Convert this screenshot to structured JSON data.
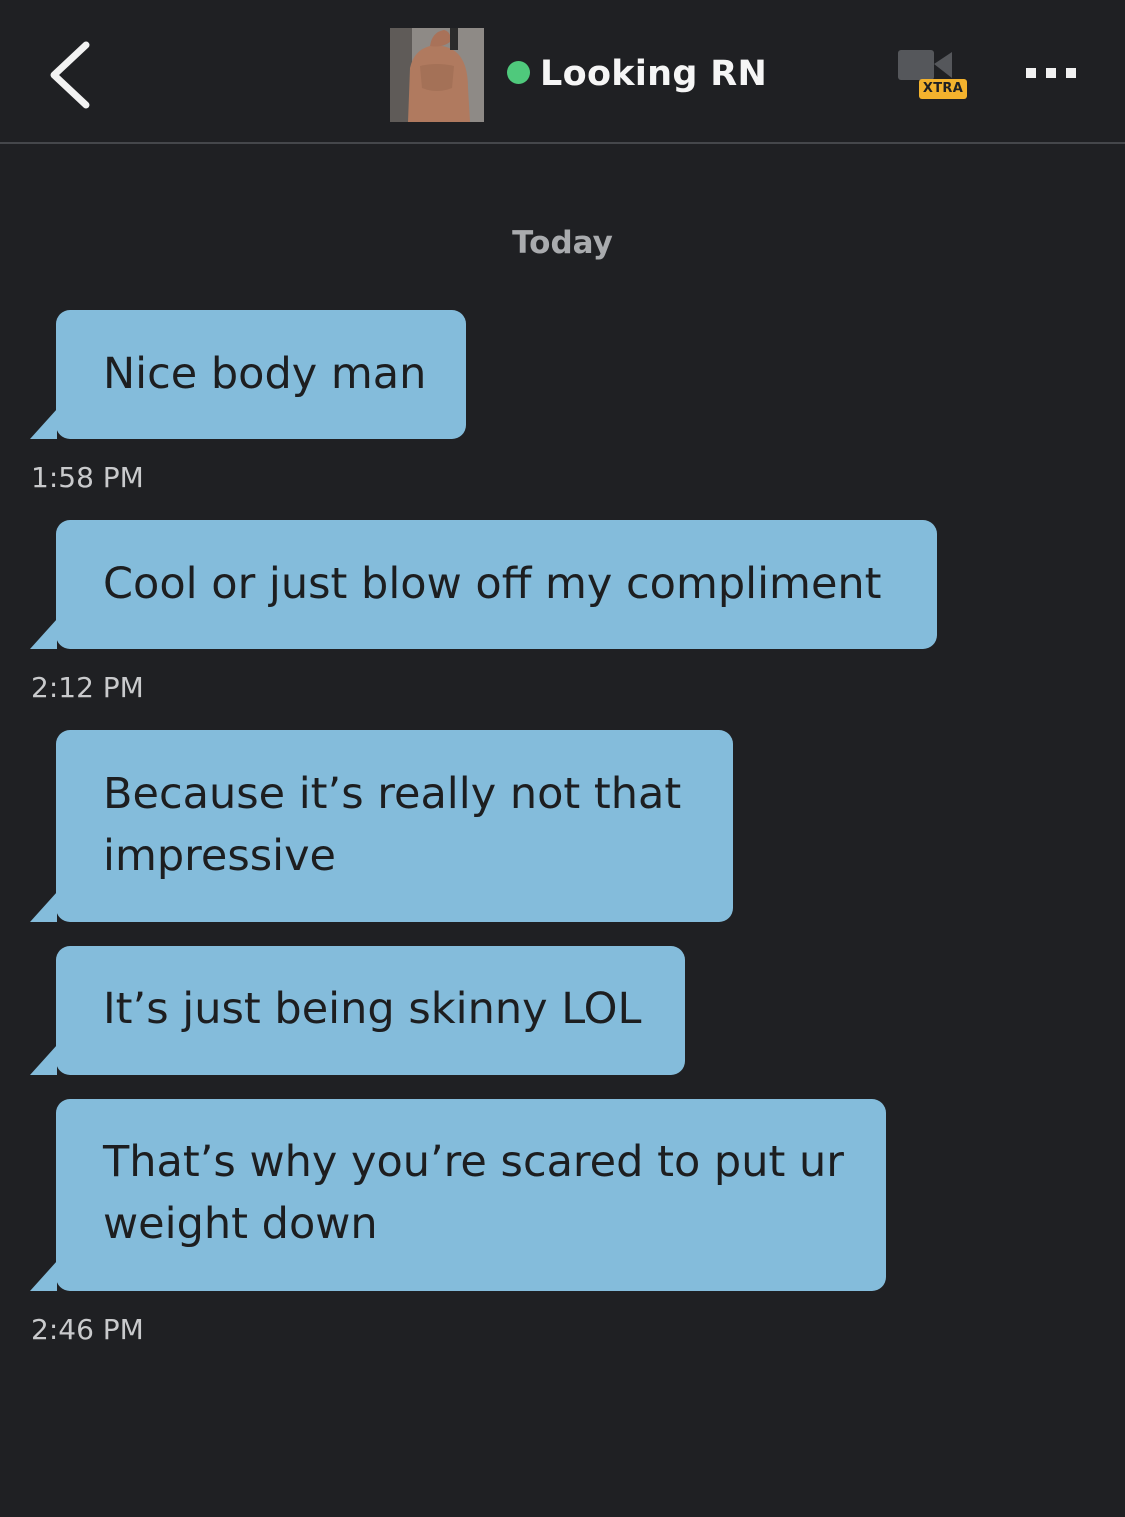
{
  "header": {
    "profile_name": "Looking RN",
    "online_status_color": "#4fc97c",
    "video_badge": "XTRA",
    "icons": {
      "back": "chevron-left-icon",
      "video": "video-camera-icon",
      "more": "more-horizontal-icon"
    }
  },
  "conversation": {
    "date_separator": "Today",
    "messages": [
      {
        "text": "Nice body man",
        "time": "1:58 PM"
      },
      {
        "text": "Cool or just blow off my compliment",
        "time": "2:12 PM"
      },
      {
        "text": "Because it’s really not that\nimpressive",
        "time": ""
      },
      {
        "text": "It’s just being skinny LOL",
        "time": ""
      },
      {
        "text": "That’s why you’re scared to put ur\nweight down",
        "time": "2:46 PM"
      }
    ]
  },
  "colors": {
    "background": "#1f2023",
    "bubble": "#84bcdb",
    "badge": "#f3b22d"
  }
}
